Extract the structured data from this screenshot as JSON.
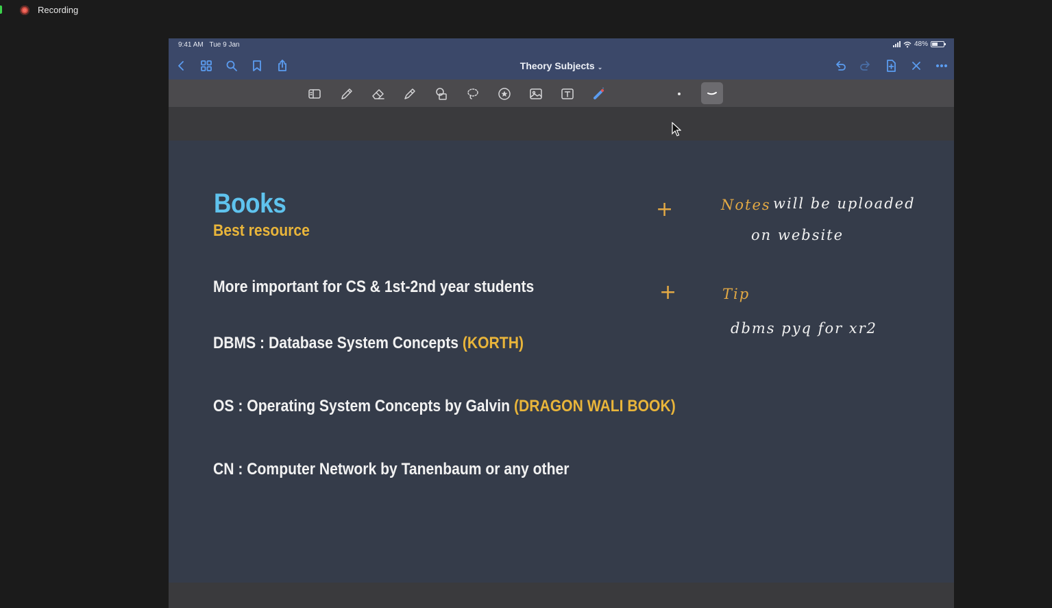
{
  "recording": {
    "label": "Recording"
  },
  "status_bar": {
    "time": "9:41 AM",
    "date": "Tue 9 Jan",
    "battery": "48%"
  },
  "nav": {
    "title": "Theory Subjects",
    "left_icons": [
      "back-icon",
      "grid-icon",
      "search-icon",
      "bookmark-icon",
      "share-icon"
    ],
    "right_icons": [
      "undo-icon",
      "redo-icon",
      "add-page-icon",
      "close-icon",
      "more-icon"
    ]
  },
  "toolbar": {
    "tools": [
      "sidebar-tool",
      "pen-tool",
      "eraser-tool",
      "highlighter-tool",
      "shapes-tool",
      "lasso-tool",
      "sticker-tool",
      "image-tool",
      "text-tool",
      "laser-tool",
      "pen-size",
      "pen-thickness"
    ]
  },
  "page": {
    "title": "Books",
    "subtitle": "Best resource",
    "line1": "More important for CS & 1st-2nd year students",
    "line2": {
      "text": "DBMS : Database System Concepts ",
      "highlight": "(KORTH)"
    },
    "line3": {
      "text": "OS : Operating System Concepts by Galvin ",
      "highlight": "(DRAGON WALI BOOK)"
    },
    "line4": "CN : Computer Network by Tanenbaum or any other"
  },
  "handwriting": {
    "plus1": "+",
    "note_gold": "Notes",
    "note_rest": "will be uploaded",
    "note_line2": "on website",
    "plus2": "+",
    "tip": "Tip",
    "tip_line": "dbms pyq for xr2"
  },
  "colors": {
    "accent": "#5b9cf0",
    "title_blue": "#5fc3ee",
    "highlight_gold": "#e9b53a",
    "page_bg": "#353c4a"
  }
}
